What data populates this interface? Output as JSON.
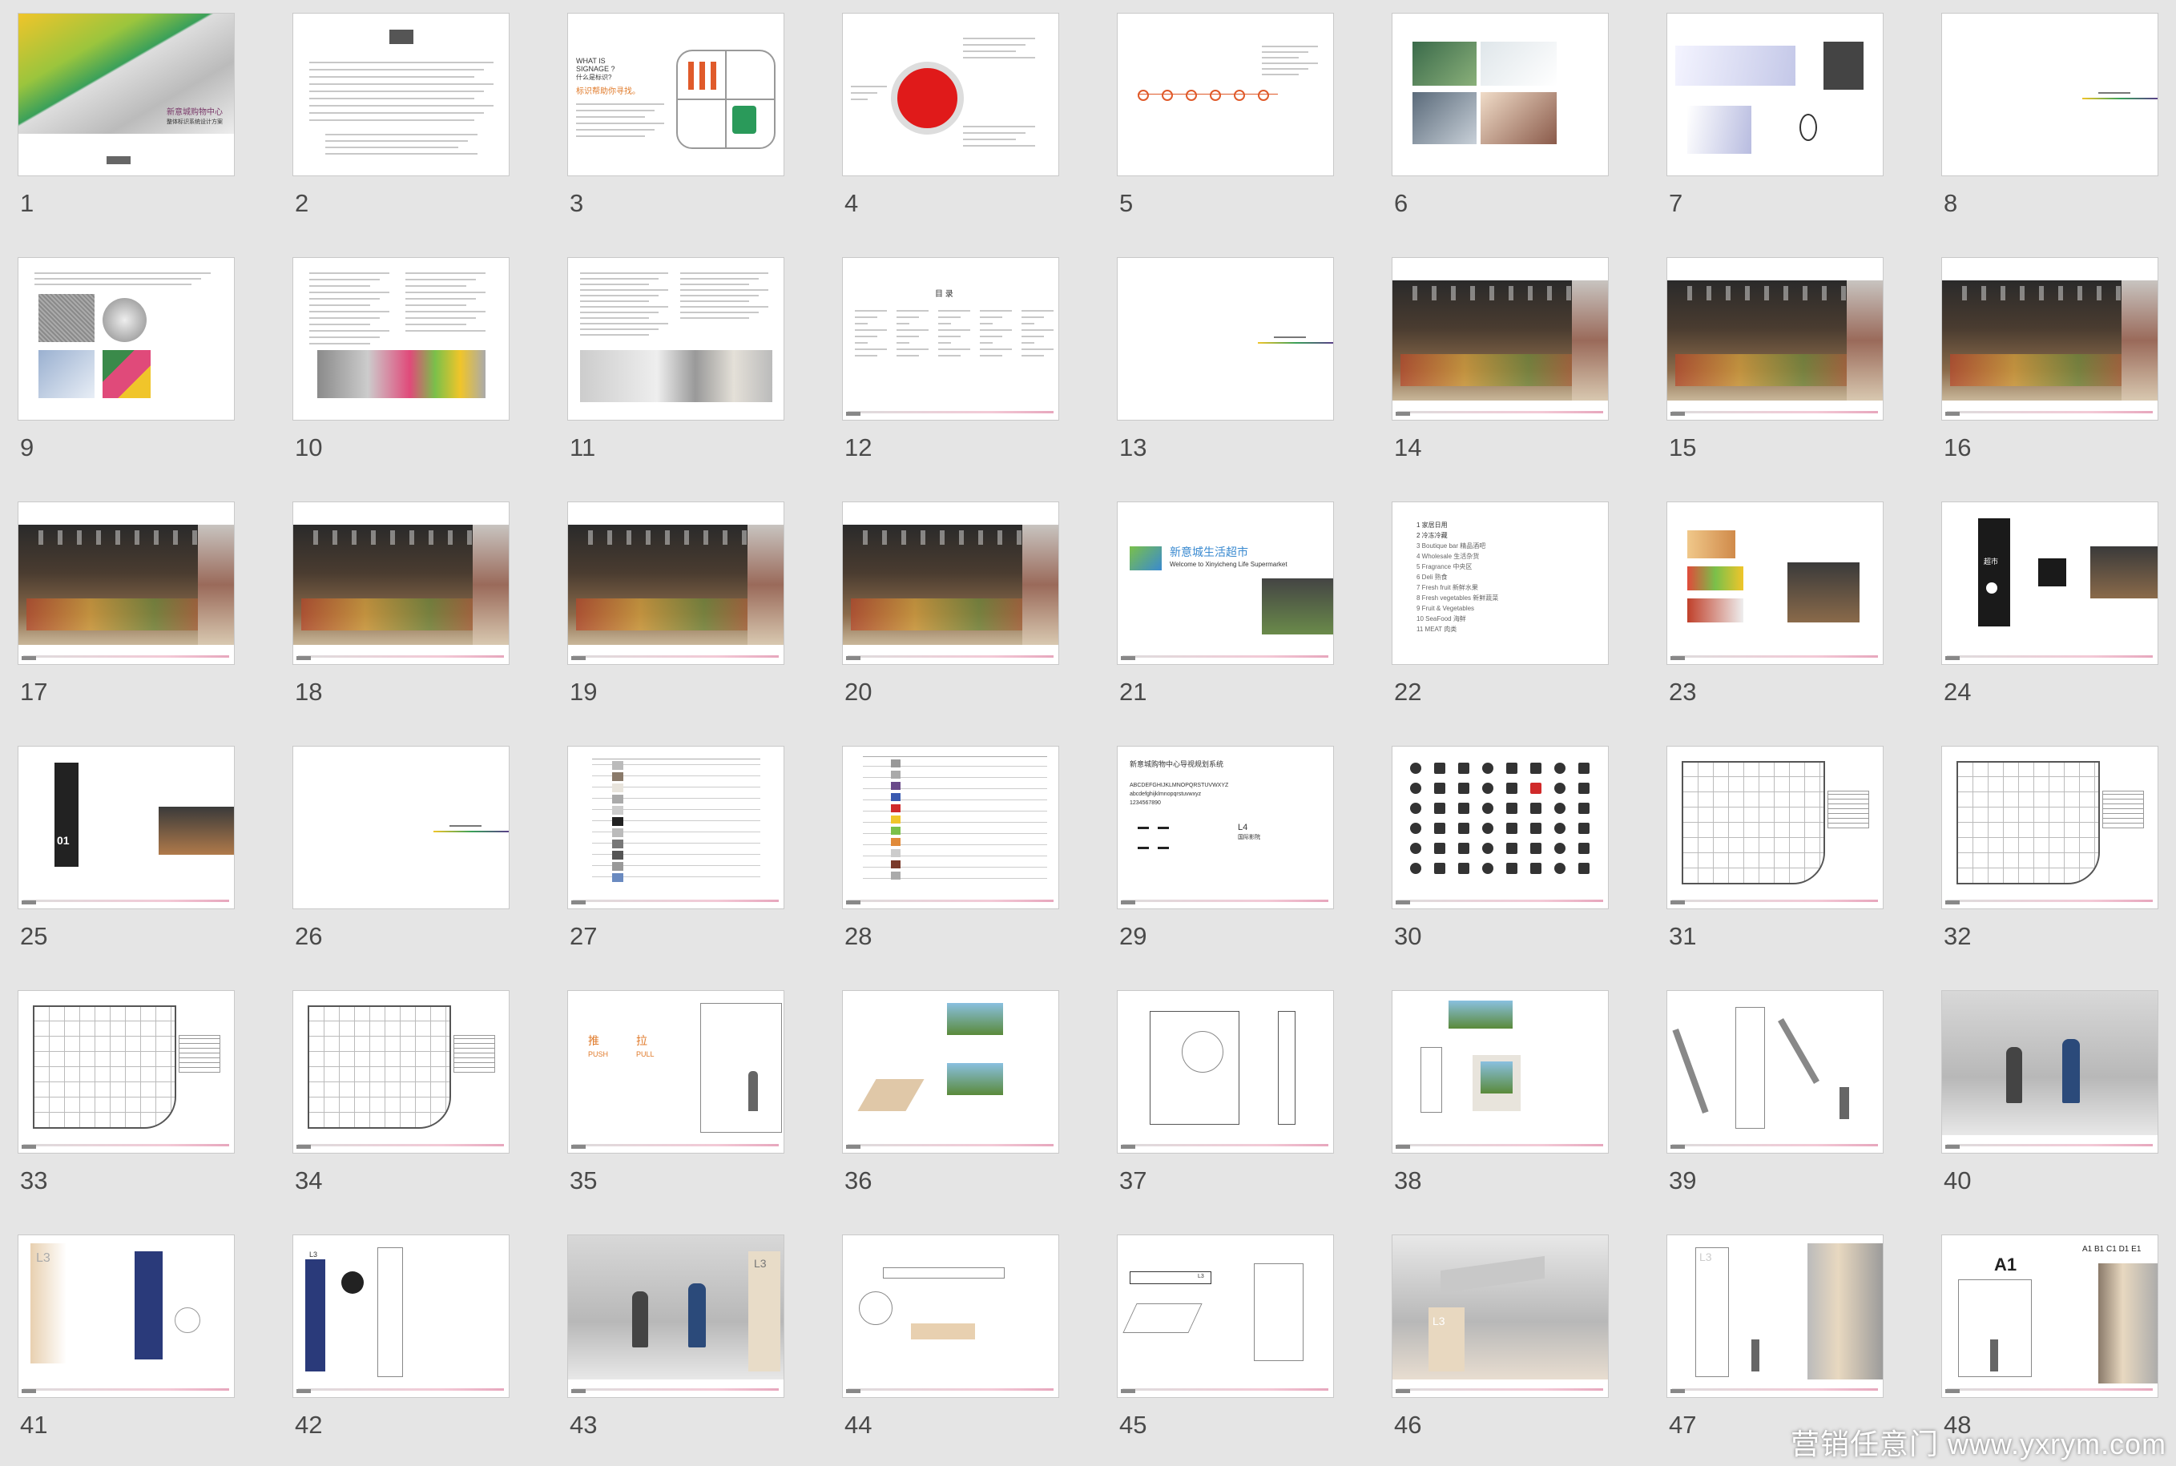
{
  "slides": [
    {
      "number": "1",
      "kind": "cover",
      "texts": [
        "新意城购物中心",
        "整体标识系统设计方案"
      ]
    },
    {
      "number": "2",
      "kind": "text"
    },
    {
      "number": "3",
      "kind": "signage",
      "texts": [
        "WHAT IS",
        "SIGNAGE ?",
        "什么是标识?",
        "标识帮助你寻找。"
      ]
    },
    {
      "number": "4",
      "kind": "circle"
    },
    {
      "number": "5",
      "kind": "flow"
    },
    {
      "number": "6",
      "kind": "photos"
    },
    {
      "number": "7",
      "kind": "ergonomics"
    },
    {
      "number": "8",
      "kind": "section"
    },
    {
      "number": "9",
      "kind": "materials"
    },
    {
      "number": "10",
      "kind": "materials2"
    },
    {
      "number": "11",
      "kind": "textphotos"
    },
    {
      "number": "12",
      "kind": "toc",
      "texts": [
        "目 录"
      ]
    },
    {
      "number": "13",
      "kind": "section"
    },
    {
      "number": "14",
      "kind": "interior"
    },
    {
      "number": "15",
      "kind": "interior"
    },
    {
      "number": "16",
      "kind": "interior"
    },
    {
      "number": "17",
      "kind": "interior"
    },
    {
      "number": "18",
      "kind": "interior"
    },
    {
      "number": "19",
      "kind": "interior"
    },
    {
      "number": "20",
      "kind": "interior"
    },
    {
      "number": "21",
      "kind": "welcome",
      "texts": [
        "新意城生活超市",
        "Welcome to Xinyicheng Life Supermarket"
      ]
    },
    {
      "number": "22",
      "kind": "list",
      "texts": [
        "1  家居日用",
        "2  冷冻冷藏",
        "3  Boutique bar 精品酒吧",
        "4  Wholesale 生活杂货",
        "5  Fragrance 中央区",
        "6  Deli 熟食",
        "7  Fresh fruit 新鲜水果",
        "8  Fresh vegetables 新鲜蔬菜",
        "9  Fruit & Vegetables",
        "10  SeaFood 海鲜",
        "11  MEAT 肉类"
      ]
    },
    {
      "number": "23",
      "kind": "food"
    },
    {
      "number": "24",
      "kind": "pylon",
      "texts": [
        "超市"
      ]
    },
    {
      "number": "25",
      "kind": "pylon01",
      "texts": [
        "01"
      ]
    },
    {
      "number": "26",
      "kind": "section"
    },
    {
      "number": "27",
      "kind": "table"
    },
    {
      "number": "28",
      "kind": "colortable"
    },
    {
      "number": "29",
      "kind": "font",
      "texts": [
        "新意城购物中心导视规划系统",
        "ABCDEFGHIJKLMNOPQRSTUVWXYZ",
        "abcdefghijklmnopqrstuvwxyz",
        "1234567890",
        "L4",
        "国际影院"
      ]
    },
    {
      "number": "30",
      "kind": "icons"
    },
    {
      "number": "31",
      "kind": "plan"
    },
    {
      "number": "32",
      "kind": "plan"
    },
    {
      "number": "33",
      "kind": "plan"
    },
    {
      "number": "34",
      "kind": "plan"
    },
    {
      "number": "35",
      "kind": "doors",
      "texts": [
        "推",
        "PUSH",
        "拉",
        "PULL"
      ]
    },
    {
      "number": "36",
      "kind": "kiosk"
    },
    {
      "number": "37",
      "kind": "drawing"
    },
    {
      "number": "38",
      "kind": "kiosk2"
    },
    {
      "number": "39",
      "kind": "drawing2"
    },
    {
      "number": "40",
      "kind": "photo"
    },
    {
      "number": "41",
      "kind": "l3sign",
      "texts": [
        "L3"
      ]
    },
    {
      "number": "42",
      "kind": "l3sign2",
      "texts": [
        "L3"
      ]
    },
    {
      "number": "43",
      "kind": "photo2",
      "texts": [
        "L3"
      ]
    },
    {
      "number": "44",
      "kind": "hanging"
    },
    {
      "number": "45",
      "kind": "hanging2",
      "texts": [
        "L3"
      ]
    },
    {
      "number": "46",
      "kind": "render",
      "texts": [
        "L3"
      ]
    },
    {
      "number": "47",
      "kind": "column",
      "texts": [
        "L3"
      ]
    },
    {
      "number": "48",
      "kind": "a1",
      "texts": [
        "A1",
        "A1 B1 C1 D1 E1"
      ]
    }
  ],
  "watermark": "营销任意门 www.yxrym.com"
}
